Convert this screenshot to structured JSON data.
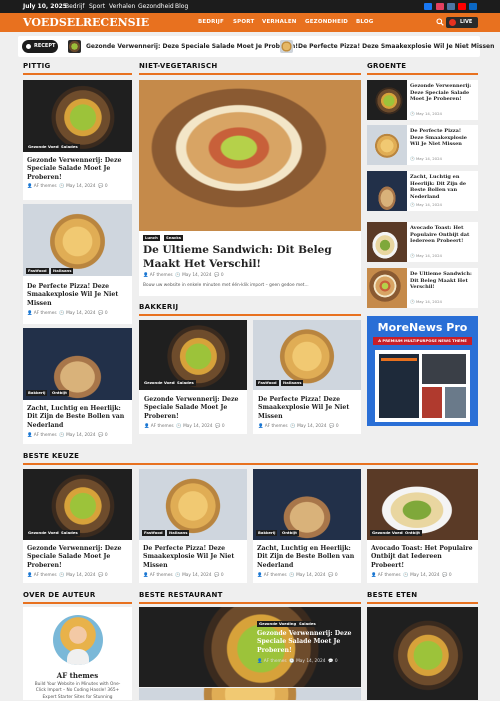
{
  "topbar": {
    "date": "July 10, 2025",
    "nav": [
      "Bedrijf",
      "Sport",
      "Verhalen",
      "Gezondheid",
      "Blog"
    ]
  },
  "header": {
    "logo": "VOEDSELRECENSIE",
    "menu": [
      "BEDRIJF",
      "SPORT",
      "VERHALEN",
      "GEZONDHEID",
      "BLOG"
    ],
    "live": "LIVE"
  },
  "ticker": {
    "label": "RECEPT",
    "items": [
      "Gezonde Verwennerij: Deze Speciale Salade Moet Je Proberen!",
      "De Perfecte Pizza! Deze Smaakexplosie Wil Je Niet Missen"
    ]
  },
  "sections": {
    "pittig": "PITTIG",
    "nonveg": "NIET-VEGETARISCH",
    "groente": "GROENTE",
    "bakkerij": "BAKKERIJ",
    "beste_keuze": "BESTE KEUZE",
    "over": "OVER DE AUTEUR",
    "beste_restaurant": "BESTE RESTAURANT",
    "beste_eten": "BESTE ETEN"
  },
  "meta": {
    "author": "AF themes",
    "date": "May 14, 2024",
    "comments": "0"
  },
  "pittig": [
    {
      "title": "Gezonde Verwennerij: Deze Speciale Salade Moet Je Proberen!",
      "tags": [
        "Gezonde Voeding",
        "Salades"
      ],
      "img": "salad"
    },
    {
      "title": "De Perfecte Pizza! Deze Smaakexplosie Wil Je Niet Missen",
      "tags": [
        "Fastfood",
        "Italiaans"
      ],
      "img": "pizza"
    },
    {
      "title": "Zacht, Luchtig en Heerlijk: Dit Zijn de Beste Bollen van Nederland",
      "tags": [
        "Bakkerij",
        "Ontbijt"
      ],
      "img": "bread"
    }
  ],
  "featured": {
    "title": "De Ultieme Sandwich: Dit Beleg Maakt Het Verschil!",
    "tags": [
      "Lunch",
      "Snacks"
    ],
    "excerpt": "Bouw uw website in enkele minuten met één-klik import – geen gedoe met..."
  },
  "bakkerij": [
    {
      "title": "Gezonde Verwennerij: Deze Speciale Salade Moet Je Proberen!",
      "tags": [
        "Gezonde Voeding",
        "Salades"
      ],
      "img": "salad"
    },
    {
      "title": "De Perfecte Pizza! Deze Smaakexplosie Wil Je Niet Missen",
      "tags": [
        "Fastfood",
        "Italiaans"
      ],
      "img": "pizza"
    }
  ],
  "groente": [
    {
      "title": "Gezonde Verwennerij: Deze Speciale Salade Moet Je Proberen!",
      "img": "salad"
    },
    {
      "title": "De Perfecte Pizza! Deze Smaakexplosie Wil Je Niet Missen",
      "img": "pizza"
    },
    {
      "title": "Zacht, Luchtig en Heerlijk: Dit Zijn de Beste Bollen van Nederland",
      "img": "bread"
    },
    {
      "title": "Avocado Toast: Het Populaire Ontbijt dat Iedereen Probeert!",
      "img": "avocado"
    },
    {
      "title": "De Ultieme Sandwich: Dit Beleg Maakt Het Verschil!",
      "img": "sandwich"
    }
  ],
  "ad": {
    "title": "MoreNews Pro",
    "subtitle": "A PREMIUM MULTIPURPOSE NEWS THEME"
  },
  "beste_keuze": [
    {
      "title": "Gezonde Verwennerij: Deze Speciale Salade Moet Je Proberen!",
      "tags": [
        "Gezonde Voeding",
        "Salades"
      ],
      "img": "salad"
    },
    {
      "title": "De Perfecte Pizza! Deze Smaakexplosie Wil Je Niet Missen",
      "tags": [
        "Fastfood",
        "Italiaans"
      ],
      "img": "pizza"
    },
    {
      "title": "Zacht, Luchtig en Heerlijk: Dit Zijn de Beste Bollen van Nederland",
      "tags": [
        "Bakkerij",
        "Ontbijt"
      ],
      "img": "bread"
    },
    {
      "title": "Avocado Toast: Het Populaire Ontbijt dat Iedereen Probeert!",
      "tags": [
        "Gezonde Voeding",
        "Ontbijt"
      ],
      "img": "avocado"
    }
  ],
  "author": {
    "name": "AF themes",
    "desc": "Build Your Website in Minutes with One-Click Import – No Coding Hassle! 365+ Expert Starter Sites for Stunning"
  },
  "restaurant": {
    "title": "Gezonde Verwennerij: Deze Speciale Salade Moet Je Proberen!",
    "tags": [
      "Gezonde Voeding",
      "Salades"
    ],
    "img": "salad"
  },
  "beste_eten": {
    "img": "salad"
  },
  "colors": {
    "accent": "#e8711f",
    "dark": "#1c1c1c",
    "ad_blue": "#2a6fd6",
    "ad_red": "#c81e28"
  },
  "icons": {
    "search": "search-icon",
    "clock": "clock-icon",
    "comment": "comment-icon",
    "user": "user-icon"
  }
}
